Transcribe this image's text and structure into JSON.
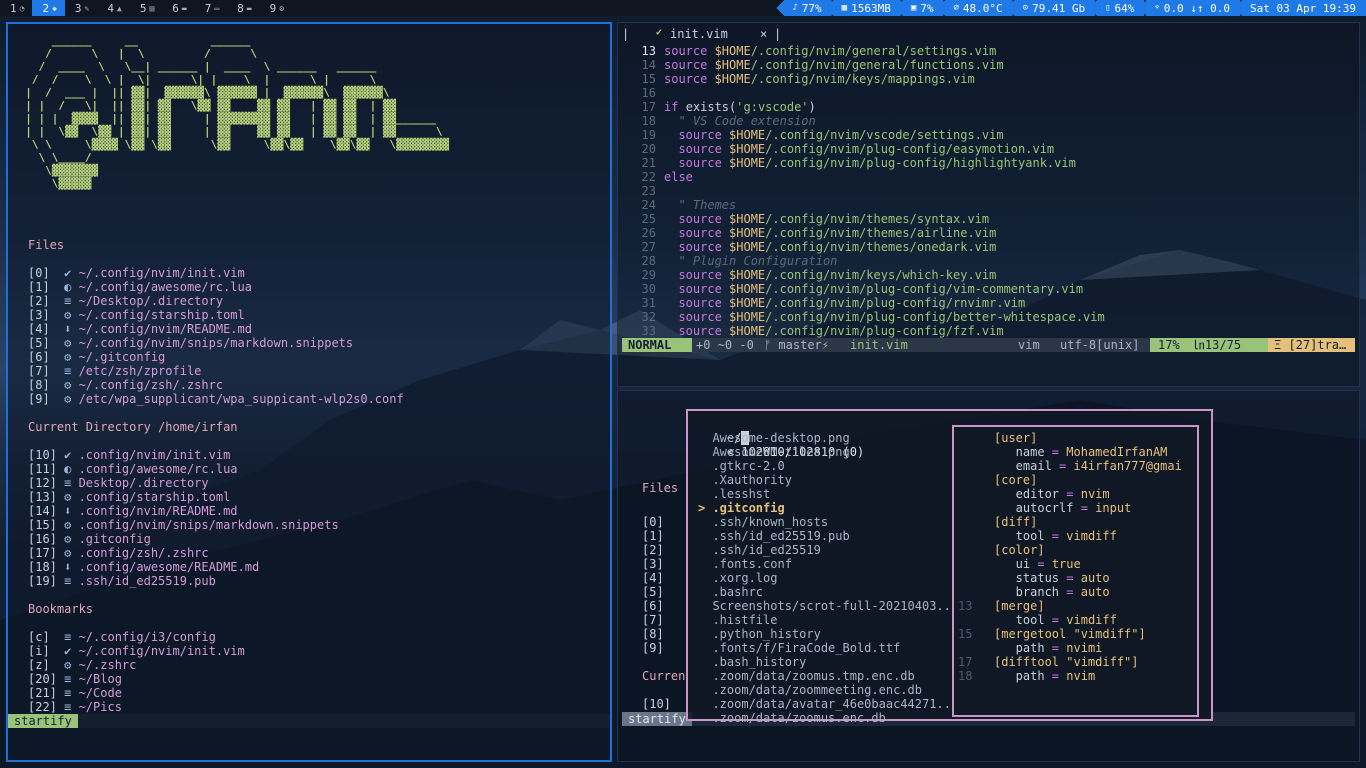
{
  "workspaces": [
    {
      "num": "1",
      "glyph": "◔",
      "active": false
    },
    {
      "num": "2",
      "glyph": "◆",
      "active": true
    },
    {
      "num": "3",
      "glyph": "✎",
      "active": false
    },
    {
      "num": "4",
      "glyph": "▲",
      "active": false
    },
    {
      "num": "5",
      "glyph": "▤",
      "active": false
    },
    {
      "num": "6",
      "glyph": "▬",
      "active": false
    },
    {
      "num": "7",
      "glyph": "▭",
      "active": false
    },
    {
      "num": "8",
      "glyph": "▬",
      "active": false
    },
    {
      "num": "9",
      "glyph": "⚙",
      "active": false
    }
  ],
  "stats": [
    {
      "icon": "♪",
      "value": "77%"
    },
    {
      "icon": "▦",
      "value": "1563MB"
    },
    {
      "icon": "▣",
      "value": "7%"
    },
    {
      "icon": "⌀",
      "value": "48.0°C"
    },
    {
      "icon": "⊙",
      "value": "79.41 Gb"
    },
    {
      "icon": "▯",
      "value": "64%"
    },
    {
      "icon": "⌔",
      "value": "0.0 ↓↑ 0.0"
    },
    {
      "icon": "",
      "value": "Sat 03 Apr 19:39"
    }
  ],
  "startify": {
    "ascii": "      ______     __           ______\n     /      \\   |  \\         /      \\\n    /  ____  \\   \\__| ______ |  ____  \\ ______   ______\n   /  /    \\  \\ |  \\|      \\| |    \\  |      \\ |      \\\n  |  /  ___ |  || ▓▓|  ▓▓▓▓▓▓\\ ▓▓▓▓▓▓ |  ▓▓▓▓▓▓\\  ▓▓▓▓▓▓\\\n  | |  /   \\|  || ▓▓| ▓▓   \\▓▓ ▓▓    ▓▓ ▓▓   | ▓▓ ▓▓  | ▓▓\n  | | |  ▓▓▓▓  || ▓▓| ▓▓     | ▓▓▓▓▓▓▓▓ ▓▓   | ▓▓ ▓▓  | ▓▓______\n  | |  \\▓▓  \\▓▓ | ▓▓| ▓▓     | ▓▓    ▓▓ ▓▓   | ▓▓ ▓▓  | ▓▓      \\\n   \\ \\     \\▓▓▓▓ \\▓▓ \\▓▓      \\▓▓     \\▓▓\\▓▓    \\▓▓\\▓▓   \\▓▓▓▓▓▓▓▓\n    \\ \\____/\n     \\▓▓▓▓▓▓▓\n      \\▓▓▓▓▓",
    "files_title": "Files",
    "files": [
      {
        "idx": "[0]",
        "icon": "✔",
        "path": "~/.config/nvim/init.vim"
      },
      {
        "idx": "[1]",
        "icon": "◐",
        "path": "~/.config/awesome/rc.lua"
      },
      {
        "idx": "[2]",
        "icon": "≡",
        "path": "~/Desktop/.directory"
      },
      {
        "idx": "[3]",
        "icon": "⚙",
        "path": "~/.config/starship.toml"
      },
      {
        "idx": "[4]",
        "icon": "⬇",
        "path": "~/.config/nvim/README.md"
      },
      {
        "idx": "[5]",
        "icon": "⚙",
        "path": "~/.config/nvim/snips/markdown.snippets"
      },
      {
        "idx": "[6]",
        "icon": "⚙",
        "path": "~/.gitconfig"
      },
      {
        "idx": "[7]",
        "icon": "≡",
        "path": "/etc/zsh/zprofile"
      },
      {
        "idx": "[8]",
        "icon": "⚙",
        "path": "~/.config/zsh/.zshrc"
      },
      {
        "idx": "[9]",
        "icon": "⚙",
        "path": "/etc/wpa_supplicant/wpa_suppicant-wlp2s0.conf"
      }
    ],
    "cwd_title": "Current Directory /home/irfan",
    "cwd": [
      {
        "idx": "[10]",
        "icon": "✔",
        "path": ".config/nvim/init.vim"
      },
      {
        "idx": "[11]",
        "icon": "◐",
        "path": ".config/awesome/rc.lua"
      },
      {
        "idx": "[12]",
        "icon": "≡",
        "path": "Desktop/.directory"
      },
      {
        "idx": "[13]",
        "icon": "⚙",
        "path": ".config/starship.toml"
      },
      {
        "idx": "[14]",
        "icon": "⬇",
        "path": ".config/nvim/README.md"
      },
      {
        "idx": "[15]",
        "icon": "⚙",
        "path": ".config/nvim/snips/markdown.snippets"
      },
      {
        "idx": "[16]",
        "icon": "⚙",
        "path": ".gitconfig"
      },
      {
        "idx": "[17]",
        "icon": "⚙",
        "path": ".config/zsh/.zshrc"
      },
      {
        "idx": "[18]",
        "icon": "⬇",
        "path": ".config/awesome/README.md"
      },
      {
        "idx": "[19]",
        "icon": "≡",
        "path": ".ssh/id_ed25519.pub"
      }
    ],
    "bookmarks_title": "Bookmarks",
    "bookmarks": [
      {
        "idx": "[c]",
        "icon": "≡",
        "path": "~/.config/i3/config"
      },
      {
        "idx": "[i]",
        "icon": "✔",
        "path": "~/.config/nvim/init.vim"
      },
      {
        "idx": "[z]",
        "icon": "⚙",
        "path": "~/.zshrc"
      },
      {
        "idx": "[20]",
        "icon": "≡",
        "path": "~/Blog"
      },
      {
        "idx": "[21]",
        "icon": "≡",
        "path": "~/Code"
      },
      {
        "idx": "[22]",
        "icon": "≡",
        "path": "~/Pics"
      }
    ],
    "status_tag": "startify"
  },
  "vim": {
    "tab_icon": "✔",
    "tab_name": "init.vim",
    "tab_close": "×",
    "lines": [
      {
        "n": "13",
        "text": "source $HOME/.config/nvim/general/settings.vim"
      },
      {
        "n": "14",
        "text": "source $HOME/.config/nvim/general/functions.vim"
      },
      {
        "n": "15",
        "text": "source $HOME/.config/nvim/keys/mappings.vim"
      },
      {
        "n": "16",
        "text": ""
      },
      {
        "n": "17",
        "text": "if exists('g:vscode')"
      },
      {
        "n": "18",
        "text": "  \" VS Code extension"
      },
      {
        "n": "19",
        "text": "  source $HOME/.config/nvim/vscode/settings.vim"
      },
      {
        "n": "20",
        "text": "  source $HOME/.config/nvim/plug-config/easymotion.vim"
      },
      {
        "n": "21",
        "text": "  source $HOME/.config/nvim/plug-config/highlightyank.vim"
      },
      {
        "n": "22",
        "text": "else"
      },
      {
        "n": "23",
        "text": ""
      },
      {
        "n": "24",
        "text": "  \" Themes"
      },
      {
        "n": "25",
        "text": "  source $HOME/.config/nvim/themes/syntax.vim"
      },
      {
        "n": "26",
        "text": "  source $HOME/.config/nvim/themes/airline.vim"
      },
      {
        "n": "27",
        "text": "  source $HOME/.config/nvim/themes/onedark.vim"
      },
      {
        "n": "28",
        "text": "  \" Plugin Configuration"
      },
      {
        "n": "29",
        "text": "  source $HOME/.config/nvim/keys/which-key.vim"
      },
      {
        "n": "30",
        "text": "  source $HOME/.config/nvim/plug-config/vim-commentary.vim"
      },
      {
        "n": "31",
        "text": "  source $HOME/.config/nvim/plug-config/rnvimr.vim"
      },
      {
        "n": "32",
        "text": "  source $HOME/.config/nvim/plug-config/better-whitespace.vim"
      },
      {
        "n": "33",
        "text": "  source $HOME/.config/nvim/plug-config/fzf.vim"
      }
    ],
    "status": {
      "mode": "NORMAL",
      "diff": "+0 ~0 -0",
      "branch": "ᚠ master⚡",
      "file": "init.vim",
      "ft": "vim",
      "enc": "utf-8[unix]",
      "pct": "17%",
      "pos": "㏑13/75",
      "col": "㏇:1",
      "trail": "Ξ [27]tra…"
    }
  },
  "ranger": {
    "header": "~/",
    "counter": "< 102810/102810 (0)",
    "items": [
      "Awesome-desktop.png",
      "AwesomeWM-tiles.png",
      ".gtkrc-2.0",
      ".Xauthority",
      ".lesshst",
      ".gitconfig",
      ".ssh/known_hosts",
      ".ssh/id_ed25519.pub",
      ".ssh/id_ed25519",
      ".fonts.conf",
      ".xorg.log",
      ".bashrc",
      "Screenshots/scrot-full-20210403..",
      ".histfile",
      ".python_history",
      ".fonts/f/FiraCode_Bold.ttf",
      ".bash_history",
      ".zoom/data/zoomus.tmp.enc.db",
      ".zoom/data/zoommeeting.enc.db",
      ".zoom/data/avatar_46e0baac44271..",
      ".zoom/data/zoomus.enc.db"
    ],
    "selected_index": 5,
    "selected_marker": ">"
  },
  "preview": [
    {
      "n": "",
      "kind": "sec",
      "a": "[user]"
    },
    {
      "n": "",
      "kind": "kv",
      "a": "name",
      "b": "MohamedIrfanAM"
    },
    {
      "n": "",
      "kind": "kv",
      "a": "email",
      "b": "i4irfan777@gmai"
    },
    {
      "n": "",
      "kind": "sec",
      "a": "[core]"
    },
    {
      "n": "",
      "kind": "kv",
      "a": "editor",
      "b": "nvim"
    },
    {
      "n": "",
      "kind": "kv",
      "a": "autocrlf",
      "b": "input"
    },
    {
      "n": "",
      "kind": "sec",
      "a": "[diff]"
    },
    {
      "n": "",
      "kind": "kv",
      "a": "tool",
      "b": "vimdiff"
    },
    {
      "n": "",
      "kind": "sec",
      "a": "[color]"
    },
    {
      "n": "",
      "kind": "kv",
      "a": "ui",
      "b": "true"
    },
    {
      "n": "",
      "kind": "kv",
      "a": "status",
      "b": "auto"
    },
    {
      "n": "",
      "kind": "kv",
      "a": "branch",
      "b": "auto"
    },
    {
      "n": "13",
      "kind": "sec",
      "a": "[merge]"
    },
    {
      "n": "",
      "kind": "kv",
      "a": "tool",
      "b": "vimdiff"
    },
    {
      "n": "15",
      "kind": "sec",
      "a": "[mergetool \"vimdiff\"]"
    },
    {
      "n": "",
      "kind": "kv",
      "a": "path",
      "b": "nvimi"
    },
    {
      "n": "17",
      "kind": "sec",
      "a": "[difftool \"vimdiff\"]"
    },
    {
      "n": "18",
      "kind": "kv",
      "a": "path",
      "b": "nvim"
    }
  ],
  "botright_bg": {
    "files_title": "Files",
    "cwd_title": "Curren",
    "idx": [
      "[0]",
      "[1]",
      "[2]",
      "[3]",
      "[4]",
      "[5]",
      "[6]",
      "[7]",
      "[8]",
      "[9]",
      "[10]"
    ],
    "status_tag": "startify"
  },
  "colors": {
    "accent": "#1f7ae8",
    "mode": "#98c379",
    "popup_border": "#c995c8"
  }
}
